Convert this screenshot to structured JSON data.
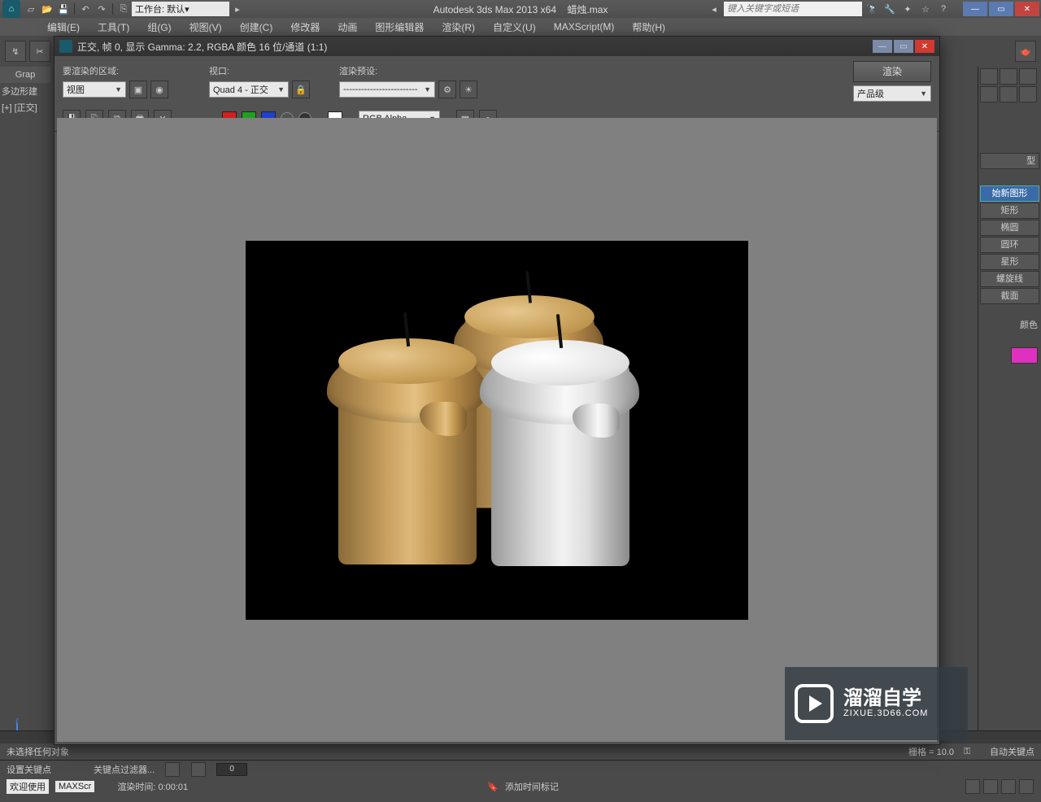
{
  "title": {
    "app": "Autodesk 3ds Max  2013 x64",
    "doc": "蜡烛.max"
  },
  "workspace_label": "工作台: 默认",
  "search_placeholder": "键入关键字或短语",
  "menu": [
    "编辑(E)",
    "工具(T)",
    "组(G)",
    "视图(V)",
    "创建(C)",
    "修改器",
    "动画",
    "图形编辑器",
    "渲染(R)",
    "自定义(U)",
    "MAXScript(M)",
    "帮助(H)"
  ],
  "left": {
    "head": "Grap",
    "sub1": "多边形建",
    "sub2": "[+] [正交]"
  },
  "right_panel": {
    "header": "型",
    "items": [
      "始新图形",
      "矩形",
      "椭圆",
      "圆环",
      "星形",
      "螺旋线",
      "截面"
    ],
    "selected_index": 0,
    "color_label": "颜色"
  },
  "render_window": {
    "title": "正交, 帧 0, 显示 Gamma: 2.2, RGBA 颜色 16 位/通道 (1:1)",
    "area_label": "要渲染的区域:",
    "area_value": "视图",
    "viewport_label": "视口:",
    "viewport_value": "Quad 4 - 正交",
    "preset_label": "渲染预设:",
    "preset_value": "-------------------------",
    "render_btn": "渲染",
    "quality_value": "产品级",
    "channel_value": "RGB Alpha"
  },
  "status": {
    "none_selected": "未选择任何对象",
    "welcome": "欢迎使用",
    "maxsc": "MAXScr",
    "render_time_label": "渲染时间:",
    "render_time_value": "0:00:01",
    "add_time_tag": "添加时间标记",
    "auto_key": "自动关键点",
    "set_key": "设置关键点",
    "key_filter": "关键点过滤器...",
    "frame": "0",
    "grid": "栅格 = 10.0"
  },
  "watermark": {
    "brand": "溜溜自学",
    "url": "ZIXUE.3D66.COM"
  }
}
